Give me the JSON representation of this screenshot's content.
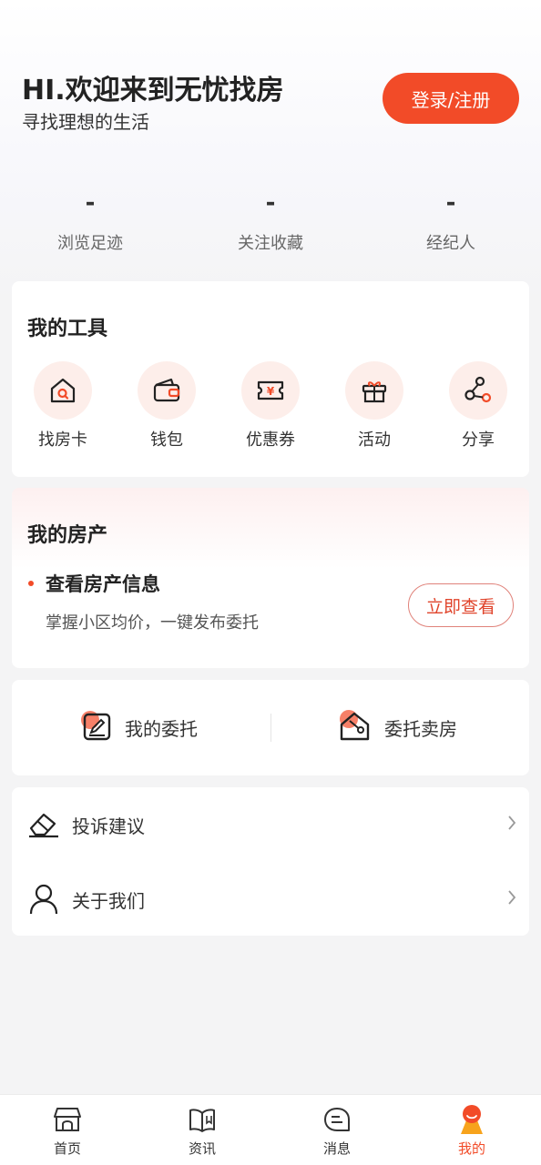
{
  "header": {
    "welcome": "HI.欢迎来到无忧找房",
    "subtitle": "寻找理想的生活",
    "login_label": "登录/注册"
  },
  "stats": [
    {
      "value": "-",
      "label": "浏览足迹"
    },
    {
      "value": "-",
      "label": "关注收藏"
    },
    {
      "value": "-",
      "label": "经纪人"
    }
  ],
  "tools": {
    "title": "我的工具",
    "items": [
      {
        "label": "找房卡",
        "icon": "house-search-icon"
      },
      {
        "label": "钱包",
        "icon": "wallet-icon"
      },
      {
        "label": "优惠券",
        "icon": "coupon-icon"
      },
      {
        "label": "活动",
        "icon": "gift-icon"
      },
      {
        "label": "分享",
        "icon": "share-icon"
      }
    ]
  },
  "property": {
    "title": "我的房产",
    "item_title": "查看房产信息",
    "item_subtitle": "掌握小区均价，一键发布委托",
    "button_label": "立即查看"
  },
  "entrust": {
    "items": [
      {
        "label": "我的委托",
        "icon": "edit-entrust-icon"
      },
      {
        "label": "委托卖房",
        "icon": "house-sell-icon"
      }
    ]
  },
  "menu": {
    "items": [
      {
        "label": "投诉建议",
        "icon": "eraser-feedback-icon"
      },
      {
        "label": "关于我们",
        "icon": "user-icon"
      }
    ]
  },
  "tabbar": {
    "items": [
      {
        "label": "首页",
        "icon": "home-store-icon",
        "active": false
      },
      {
        "label": "资讯",
        "icon": "book-icon",
        "active": false
      },
      {
        "label": "消息",
        "icon": "message-icon",
        "active": false
      },
      {
        "label": "我的",
        "icon": "profile-icon",
        "active": true
      }
    ]
  },
  "colors": {
    "accent": "#f24b28",
    "icon_bg": "#fdeeea",
    "page_bg": "#f4f4f5"
  }
}
